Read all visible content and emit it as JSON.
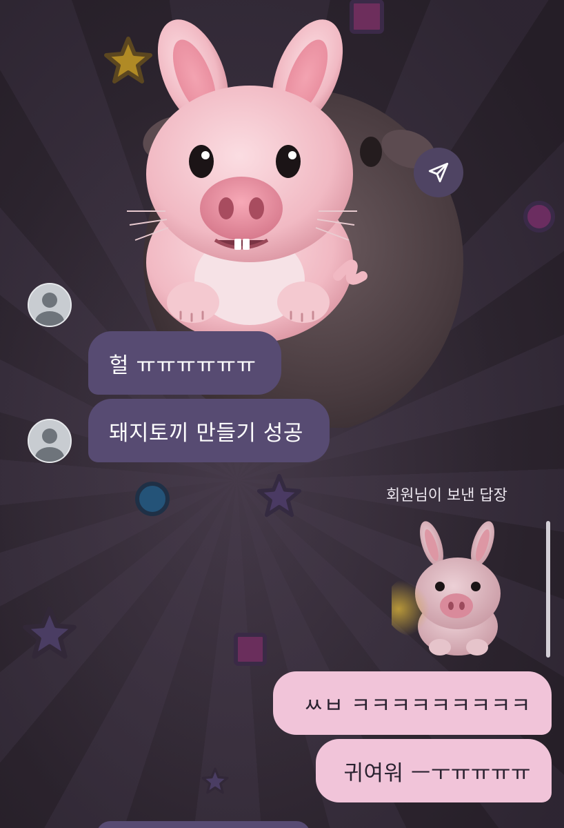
{
  "messages": {
    "received_1": "헐 ㅠㅠㅠㅠㅠㅠ",
    "received_2": "돼지토끼 만들기 성공",
    "reply_label": "회원님이 보낸 답장",
    "sent_1": "ㅆㅂ ㅋㅋㅋㅋㅋㅋㅋㅋㅋ",
    "sent_2": "귀여워 ㅡㅜㅠㅠㅠㅠ"
  },
  "icons": {
    "send": "send-icon",
    "avatar": "default-avatar-icon",
    "sticker": "pig-bunny-sticker"
  },
  "colors": {
    "received_bubble": "#574b72",
    "sent_bubble": "#f1c4d9",
    "background": "#2e2630"
  }
}
